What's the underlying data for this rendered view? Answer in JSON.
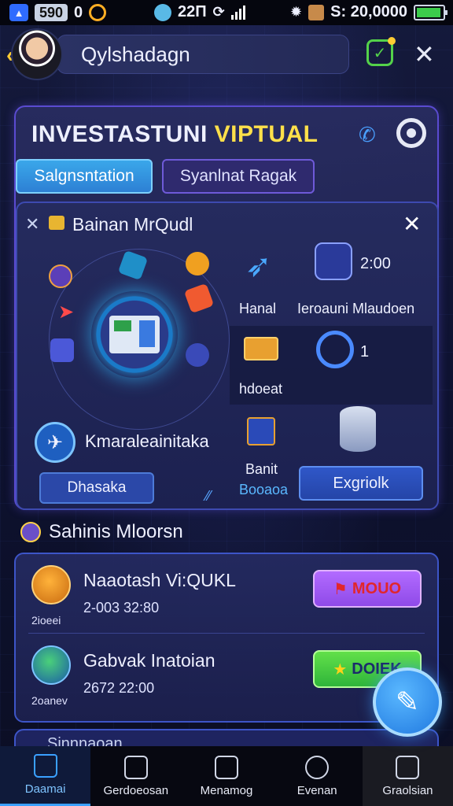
{
  "status_bar": {
    "left_text": "590",
    "left_suffix": "0",
    "mid_text": "22П",
    "right_text": "S: 20,0000",
    "battery_level": 0.95
  },
  "header": {
    "title": "Qylshadagn"
  },
  "main_card": {
    "title_part1": "INVESTASTUNI ",
    "title_part2": "VIPTUAL",
    "tabs": [
      {
        "label": "Salgnsntation"
      },
      {
        "label": "Syanlnat Ragak"
      }
    ],
    "panel": {
      "title": "Bainan MrQudl",
      "left_feature_label": "Kmaraleainitaka",
      "left_button": "Dhasaka",
      "right_items": [
        {
          "label": "Hanal"
        },
        {
          "label": "Ieroauni Mlaudoen",
          "value": "2:00"
        },
        {
          "label": "hdoeat"
        },
        {
          "label": "",
          "value": "1"
        },
        {
          "label": "Banit"
        },
        {
          "label": "Booaoa"
        }
      ],
      "right_button": "Exgriolk"
    }
  },
  "section": {
    "title": "Sahinis Mloorsn"
  },
  "list": [
    {
      "name": "Naaotash Vi:QUKL",
      "time": "2-003 32:80",
      "sub": "2ioeei",
      "button": "MOUO"
    },
    {
      "name": "Gabvak Inatoian",
      "time": "2672 22:00",
      "sub": "2oanev",
      "button": "DOIEK"
    }
  ],
  "peek_text": "Sinnnaoan",
  "bottom_nav": [
    {
      "label": "Daamai"
    },
    {
      "label": "Gerdoeosan"
    },
    {
      "label": "Menamog"
    },
    {
      "label": "Evenan"
    },
    {
      "label": "Graolsian"
    }
  ]
}
